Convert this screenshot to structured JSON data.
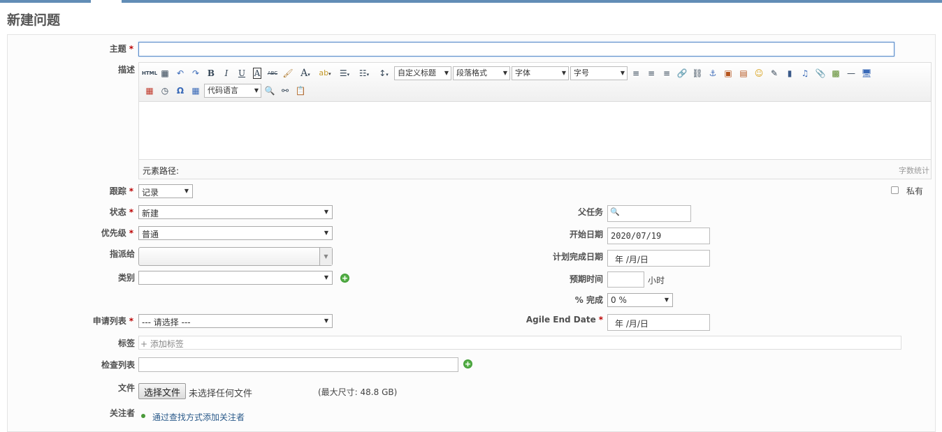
{
  "page": {
    "title": "新建问题"
  },
  "form": {
    "subject_label": "主题",
    "description_label": "描述",
    "required_mark": "*",
    "tracker": {
      "label": "跟踪",
      "value": "记录"
    },
    "private": {
      "label": "私有",
      "checked": false
    },
    "status": {
      "label": "状态",
      "value": "新建"
    },
    "priority": {
      "label": "优先级",
      "value": "普通"
    },
    "assignee": {
      "label": "指派给",
      "value": ""
    },
    "category": {
      "label": "类别",
      "value": ""
    },
    "request_list": {
      "label": "申请列表",
      "value": "--- 请选择 ---"
    },
    "tags": {
      "label": "标签",
      "placeholder": "+ 添加标签"
    },
    "checklist": {
      "label": "检查列表"
    },
    "file": {
      "label": "文件",
      "button": "选择文件",
      "status": "未选择任何文件",
      "maxsize": "(最大尺寸: 48.8 GB)"
    },
    "watchers": {
      "label": "关注者",
      "link": "通过查找方式添加关注者"
    },
    "parent_task": {
      "label": "父任务"
    },
    "start_date": {
      "label": "开始日期",
      "value": "2020/07/19"
    },
    "due_date": {
      "label": "计划完成日期",
      "value": "年 /月/日"
    },
    "estimated": {
      "label": "预期时间",
      "unit": "小时"
    },
    "done_ratio": {
      "label": "% 完成",
      "value": "0 %"
    },
    "agile_end": {
      "label": "Agile End Date",
      "value": "年 /月/日"
    }
  },
  "editor": {
    "heading_select": "自定义标题",
    "paragraph_select": "段落格式",
    "font_select": "字体",
    "size_select": "字号",
    "code_select": "代码语言",
    "path_label": "元素路径:",
    "word_count": "字数统计",
    "html_label": "HTML",
    "bold": "B",
    "italic": "I",
    "underline": "U",
    "font_color": "A",
    "strike": "ABC",
    "omega": "Ω",
    "hr": "—"
  }
}
